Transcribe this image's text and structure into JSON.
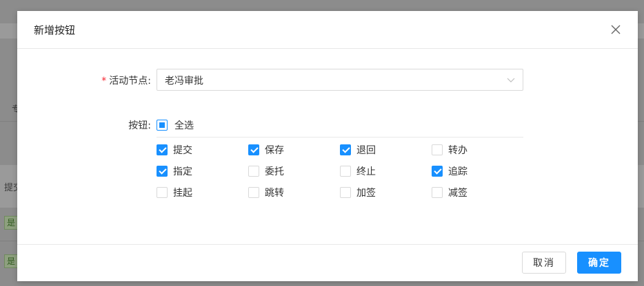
{
  "background": {
    "fragments": [
      {
        "id": "left-char-1",
        "text": "专"
      },
      {
        "id": "left-char-2",
        "text": "提交"
      }
    ],
    "tags": [
      "是",
      "是"
    ]
  },
  "modal": {
    "title": "新增按钮",
    "close_icon": "close-icon",
    "form": {
      "activity_node": {
        "label": "活动节点:",
        "required_mark": "*",
        "value": "老冯审批",
        "arrow_icon": "chevron-down-icon"
      },
      "buttons": {
        "label": "按钮:",
        "select_all": {
          "label": "全选",
          "state": "indeterminate"
        },
        "options": [
          {
            "label": "提交",
            "checked": true
          },
          {
            "label": "保存",
            "checked": true
          },
          {
            "label": "退回",
            "checked": true
          },
          {
            "label": "转办",
            "checked": false
          },
          {
            "label": "指定",
            "checked": true
          },
          {
            "label": "委托",
            "checked": false
          },
          {
            "label": "终止",
            "checked": false
          },
          {
            "label": "追踪",
            "checked": true
          },
          {
            "label": "挂起",
            "checked": false
          },
          {
            "label": "跳转",
            "checked": false
          },
          {
            "label": "加签",
            "checked": false
          },
          {
            "label": "减签",
            "checked": false
          }
        ]
      }
    },
    "footer": {
      "cancel_label": "取消",
      "ok_label": "确定"
    }
  },
  "colors": {
    "primary": "#1890ff",
    "required": "#f5222d",
    "overlay": "#8c8c8c"
  }
}
